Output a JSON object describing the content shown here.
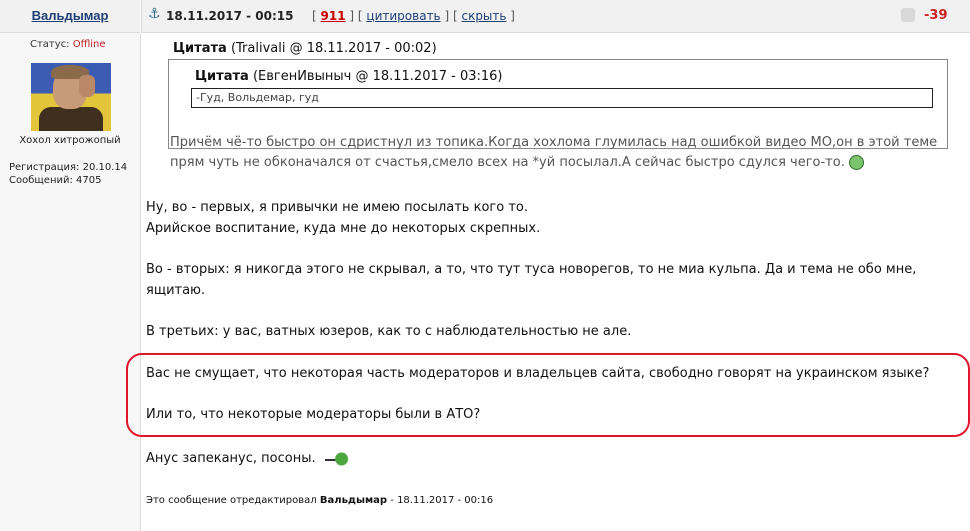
{
  "post": {
    "author": "Вальдымар",
    "date": "18.11.2017 - 00:15",
    "links": {
      "open": "[",
      "number": "911",
      "sep1": "] [",
      "cite": "цитировать",
      "sep2": "] [",
      "hide": "скрыть",
      "close": "]"
    },
    "rating": "-39"
  },
  "sidebar": {
    "status_label": "Статус:",
    "status_value": "Offline",
    "user_title": "Хохол хитрожопый",
    "registration": "Регистрация: 20.10.14",
    "messages": "Сообщений: 4705"
  },
  "quote": {
    "outer_label": "Цитата",
    "outer_meta": "(Tralivali @ 18.11.2017 - 00:02)",
    "inner_label": "Цитата",
    "inner_meta": "(ЕвгенИвыныч @ 18.11.2017 - 03:16)",
    "inner_text": "-Гуд, Вольдемар, гуд",
    "text": "Причём чё-то быстро он сдристнул из топика.Когда хохлома глумилась над ошибкой видео МО,он в этой теме прям чуть не обконачался от счастья,смело всех на *уй посылал.А сейчас быстро сдулся чего-то."
  },
  "body": {
    "p1_l1": "Ну, во - первых, я привычки не имею посылать кого то.",
    "p1_l2": "Арийское воспитание, куда мне до некоторых скрепных.",
    "p2_l1": "Во - вторых: я никогда этого не скрывал, а то, что тут туса новорегов, то не миа кульпа. Да и тема не обо мне,",
    "p2_l2": "ящитаю.",
    "p3": "В третьих: у вас, ватных юзеров, как то с наблюдательностью не але.",
    "p4": "Вас не смущает, что некоторая часть модераторов и владельцев сайта, свободно говорят на украинском языке?",
    "p5": "Или то, что некоторые модераторы были в АТО?",
    "p6": "Анус запеканус, посоны."
  },
  "edit_note": {
    "prefix": "Это сообщение отредактировал",
    "editor": "Вальдымар",
    "suffix": "- 18.11.2017 - 00:16"
  },
  "colors": {
    "highlight": "#e0162b",
    "rating": "#cc2222",
    "link": "#1e3f75"
  }
}
